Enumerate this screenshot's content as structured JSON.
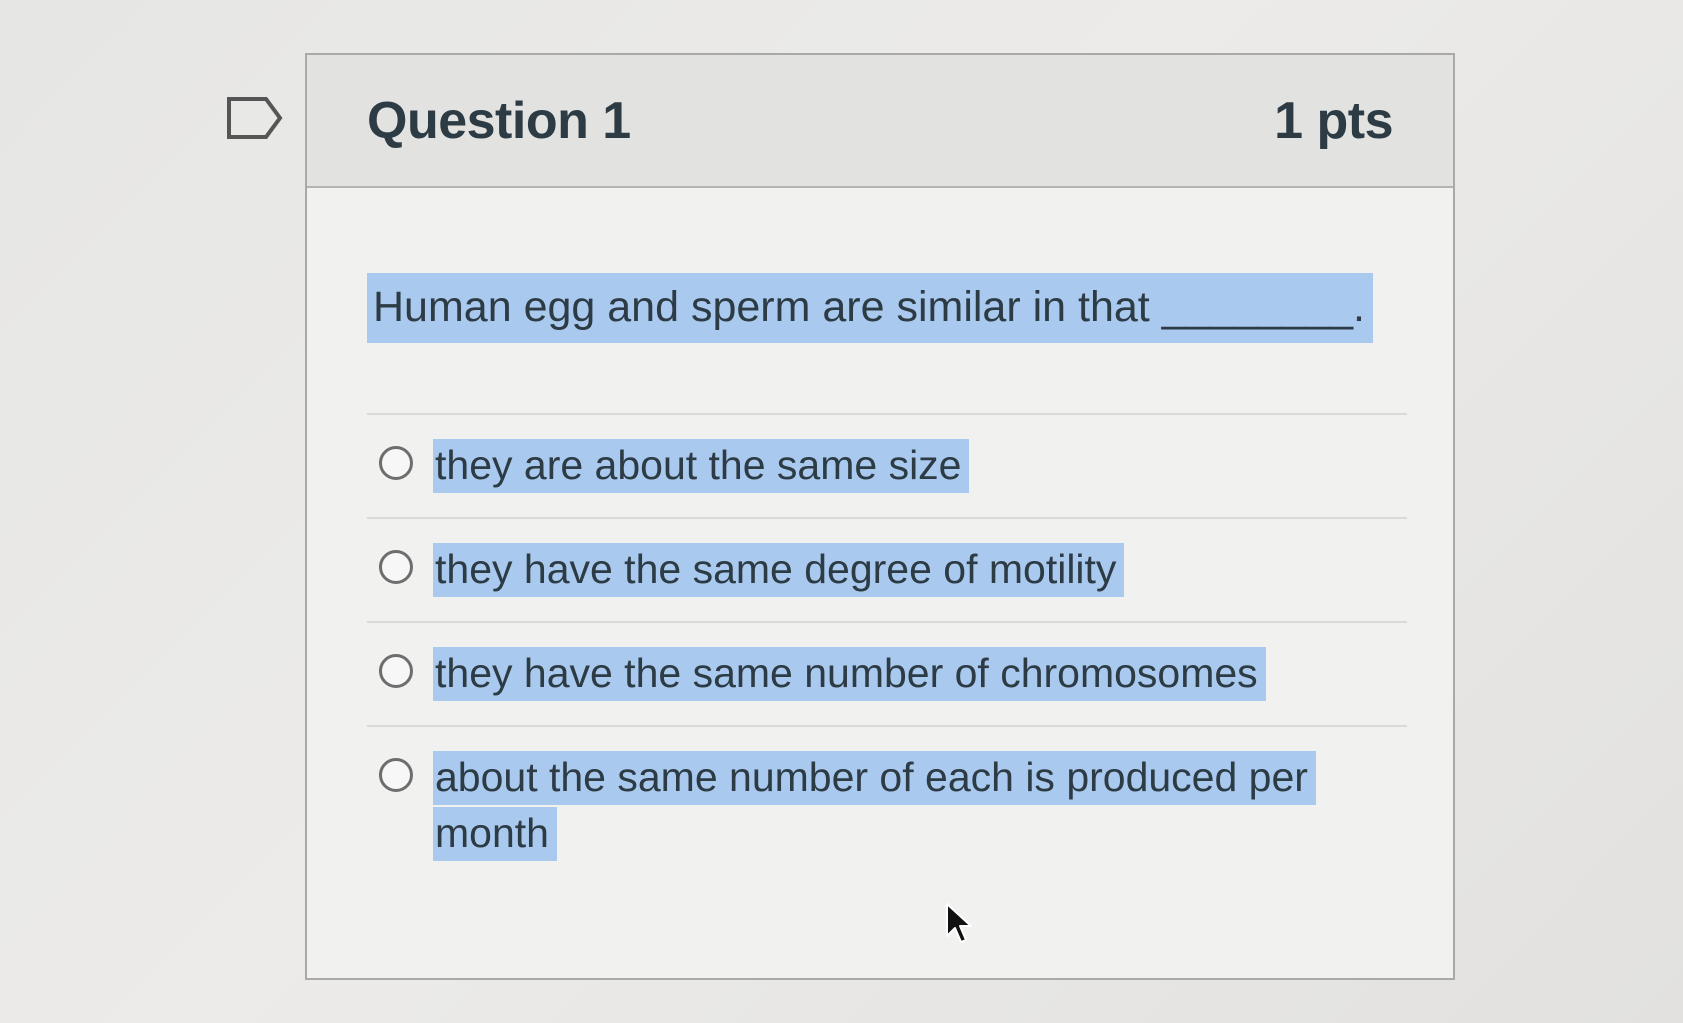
{
  "question": {
    "title": "Question 1",
    "points": "1 pts",
    "text": "Human egg and sperm are similar in that ________."
  },
  "answers": [
    {
      "label": "they are about the same size"
    },
    {
      "label": "they have the same degree of motility"
    },
    {
      "label": "they have the same number of chromosomes"
    },
    {
      "label": "about the same number of each is produced per month"
    }
  ],
  "colors": {
    "highlight": "#a9c9ee",
    "text": "#2d3b45"
  },
  "icons": {
    "flag": "flag-question-icon",
    "cursor": "mouse-pointer-icon"
  }
}
